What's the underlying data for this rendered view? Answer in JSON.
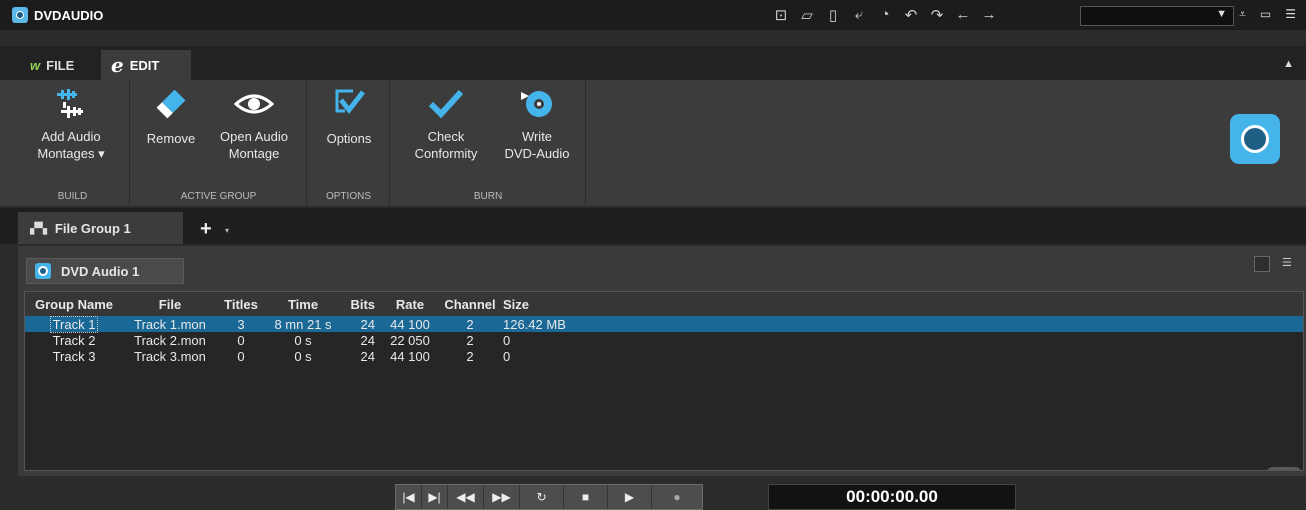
{
  "app": {
    "title": "DVDAUDIO"
  },
  "titlebar": {
    "icons": [
      "new-file-icon",
      "open-folder-icon",
      "save-icon",
      "save-as-icon",
      "history-icon",
      "undo-icon",
      "redo-icon",
      "back-icon",
      "forward-icon"
    ],
    "combo_value": "",
    "combo_arrow": "▼"
  },
  "tabs": [
    {
      "label": "FILE"
    },
    {
      "label": "EDIT"
    }
  ],
  "ribbon": {
    "groups": {
      "build": "BUILD",
      "active_group": "ACTIVE GROUP",
      "options": "OPTIONS",
      "burn": "BURN"
    },
    "buttons": {
      "add_audio_line1": "Add Audio",
      "add_audio_line2": "Montages",
      "add_audio_dropdown": "▾",
      "remove": "Remove",
      "open_audio_line1": "Open Audio",
      "open_audio_line2": "Montage",
      "options": "Options",
      "check_line1": "Check",
      "check_line2": "Conformity",
      "write_line1": "Write",
      "write_line2": "DVD-Audio"
    }
  },
  "group_tabs": {
    "active": "File Group 1",
    "add": "+",
    "add_arrow": "▾"
  },
  "panel": {
    "subtab": "DVD Audio 1"
  },
  "table": {
    "columns": [
      "Group Name",
      "File",
      "Titles",
      "Time",
      "Bits",
      "Rate",
      "Channel",
      "Size"
    ],
    "rows": [
      [
        "Track 1",
        "Track 1.mon",
        "3",
        "8 mn 21 s",
        "24",
        "44 100",
        "2",
        "126.42 MB"
      ],
      [
        "Track 2",
        "Track 2.mon",
        "0",
        "0 s",
        "24",
        "22 050",
        "2",
        "0"
      ],
      [
        "Track 3",
        "Track 3.mon",
        "0",
        "0 s",
        "24",
        "44 100",
        "2",
        "0"
      ]
    ],
    "selected_row": 0
  },
  "transport": {
    "buttons": [
      "go-to-start-icon",
      "go-to-end-icon",
      "rewind-icon",
      "fast-forward-icon",
      "loop-icon",
      "stop-icon",
      "play-icon",
      "record-icon"
    ],
    "timecode": "00:00:00.00"
  },
  "colors": {
    "accent": "#45b4eb",
    "selection": "#1a6896",
    "background": "#2b2b2b"
  }
}
